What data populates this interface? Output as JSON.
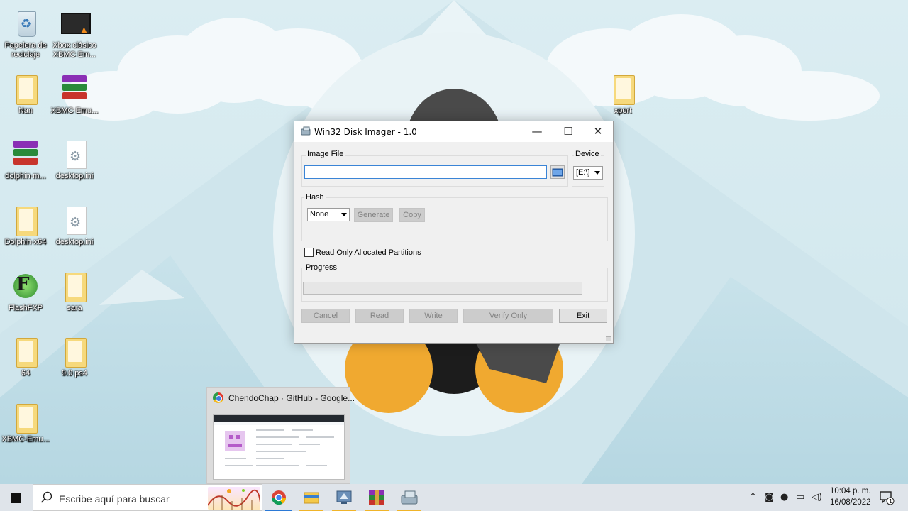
{
  "desktop": {
    "icons": [
      {
        "label": "Papelera de reciclaje",
        "icon": "recycle-bin-icon"
      },
      {
        "label": "Xbox clásico XBMC Em...",
        "icon": "video-file-icon"
      },
      {
        "label": "Nan",
        "icon": "folder-icon"
      },
      {
        "label": "XBMC Emu...",
        "icon": "winrar-archive-icon"
      },
      {
        "label": "dolphin-m...",
        "icon": "winrar-archive-icon"
      },
      {
        "label": "desktop.ini",
        "icon": "settings-file-icon"
      },
      {
        "label": "Dolphin-x64",
        "icon": "folder-icon"
      },
      {
        "label": "desktop.ini",
        "icon": "settings-file-icon"
      },
      {
        "label": "FlashFXP",
        "icon": "flashfxp-shortcut-icon"
      },
      {
        "label": "sara",
        "icon": "vlc-folder-icon"
      },
      {
        "label": "64",
        "icon": "folder-icon"
      },
      {
        "label": "9.0 ps4",
        "icon": "folder-icon"
      },
      {
        "label": "XBMC-Emu...",
        "icon": "folder-icon"
      },
      {
        "label": "xport",
        "icon": "folder-icon"
      }
    ]
  },
  "dialog": {
    "title": "Win32 Disk Imager - 1.0",
    "image_file_label": "Image File",
    "image_file_value": "",
    "device_label": "Device",
    "device_value": "[E:\\]",
    "hash_label": "Hash",
    "hash_value": "None",
    "generate_label": "Generate",
    "copy_label": "Copy",
    "readonly_label": "Read Only Allocated Partitions",
    "readonly_checked": false,
    "progress_label": "Progress",
    "progress_fraction": 0,
    "cancel_label": "Cancel",
    "read_label": "Read",
    "write_label": "Write",
    "verify_label": "Verify Only",
    "exit_label": "Exit"
  },
  "taskbar": {
    "search_placeholder": "Escribe aquí para buscar",
    "preview_title": "ChendoChap · GitHub - Google...",
    "apps": [
      "chrome-icon",
      "file-explorer-icon",
      "remote-desktop-icon",
      "winrar-icon",
      "disk-imager-icon"
    ],
    "clock_time": "10:04 p. m.",
    "clock_date": "16/08/2022",
    "notification_count": "1"
  },
  "colors": {
    "accent": "#2b79d6",
    "wallpaper_sky": "#d8ecf1",
    "penguin_orange": "#f0a930"
  }
}
